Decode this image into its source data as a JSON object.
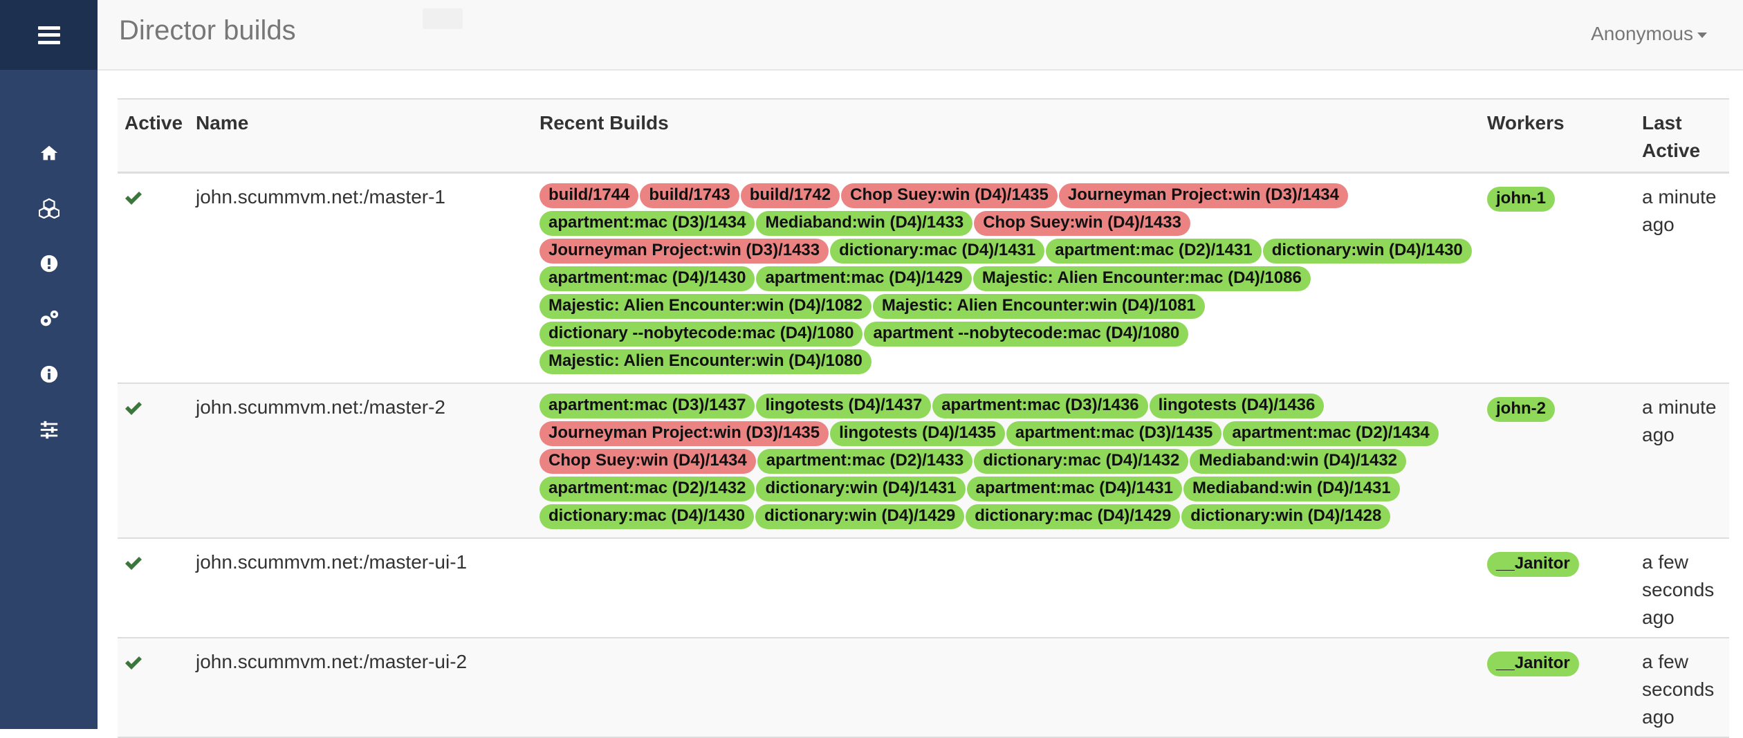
{
  "header": {
    "title": "Director builds",
    "user": "Anonymous"
  },
  "sidebar": {
    "items": [
      {
        "icon": "home-icon"
      },
      {
        "icon": "cubes-icon"
      },
      {
        "icon": "exclamation-icon"
      },
      {
        "icon": "gears-icon"
      },
      {
        "icon": "info-icon"
      },
      {
        "icon": "sliders-icon"
      }
    ]
  },
  "table": {
    "columns": [
      "Active",
      "Name",
      "Recent Builds",
      "Workers",
      "Last Active"
    ],
    "rows": [
      {
        "active": true,
        "name": "john.scummvm.net:/master-1",
        "builds": [
          {
            "label": "build/1744",
            "status": "fail"
          },
          {
            "label": "build/1743",
            "status": "fail"
          },
          {
            "label": "build/1742",
            "status": "fail"
          },
          {
            "label": "Chop Suey:win (D4)/1435",
            "status": "fail"
          },
          {
            "label": "Journeyman Project:win (D3)/1434",
            "status": "fail"
          },
          {
            "label": "apartment:mac (D3)/1434",
            "status": "ok"
          },
          {
            "label": "Mediaband:win (D4)/1433",
            "status": "ok"
          },
          {
            "label": "Chop Suey:win (D4)/1433",
            "status": "fail"
          },
          {
            "label": "Journeyman Project:win (D3)/1433",
            "status": "fail"
          },
          {
            "label": "dictionary:mac (D4)/1431",
            "status": "ok"
          },
          {
            "label": "apartment:mac (D2)/1431",
            "status": "ok"
          },
          {
            "label": "dictionary:win (D4)/1430",
            "status": "ok"
          },
          {
            "label": "apartment:mac (D4)/1430",
            "status": "ok"
          },
          {
            "label": "apartment:mac (D4)/1429",
            "status": "ok"
          },
          {
            "label": "Majestic: Alien Encounter:mac (D4)/1086",
            "status": "ok"
          },
          {
            "label": "Majestic: Alien Encounter:win (D4)/1082",
            "status": "ok"
          },
          {
            "label": "Majestic: Alien Encounter:win (D4)/1081",
            "status": "ok"
          },
          {
            "label": "dictionary --nobytecode:mac (D4)/1080",
            "status": "ok"
          },
          {
            "label": "apartment --nobytecode:mac (D4)/1080",
            "status": "ok"
          },
          {
            "label": "Majestic: Alien Encounter:win (D4)/1080",
            "status": "ok"
          }
        ],
        "worker": "john-1",
        "last_active": "a minute ago"
      },
      {
        "active": true,
        "name": "john.scummvm.net:/master-2",
        "builds": [
          {
            "label": "apartment:mac (D3)/1437",
            "status": "ok"
          },
          {
            "label": "lingotests (D4)/1437",
            "status": "ok"
          },
          {
            "label": "apartment:mac (D3)/1436",
            "status": "ok"
          },
          {
            "label": "lingotests (D4)/1436",
            "status": "ok"
          },
          {
            "label": "Journeyman Project:win (D3)/1435",
            "status": "fail"
          },
          {
            "label": "lingotests (D4)/1435",
            "status": "ok"
          },
          {
            "label": "apartment:mac (D3)/1435",
            "status": "ok"
          },
          {
            "label": "apartment:mac (D2)/1434",
            "status": "ok"
          },
          {
            "label": "Chop Suey:win (D4)/1434",
            "status": "fail"
          },
          {
            "label": "apartment:mac (D2)/1433",
            "status": "ok"
          },
          {
            "label": "dictionary:mac (D4)/1432",
            "status": "ok"
          },
          {
            "label": "Mediaband:win (D4)/1432",
            "status": "ok"
          },
          {
            "label": "apartment:mac (D2)/1432",
            "status": "ok"
          },
          {
            "label": "dictionary:win (D4)/1431",
            "status": "ok"
          },
          {
            "label": "apartment:mac (D4)/1431",
            "status": "ok"
          },
          {
            "label": "Mediaband:win (D4)/1431",
            "status": "ok"
          },
          {
            "label": "dictionary:mac (D4)/1430",
            "status": "ok"
          },
          {
            "label": "dictionary:win (D4)/1429",
            "status": "ok"
          },
          {
            "label": "dictionary:mac (D4)/1429",
            "status": "ok"
          },
          {
            "label": "dictionary:win (D4)/1428",
            "status": "ok"
          }
        ],
        "worker": "john-2",
        "last_active": "a minute ago"
      },
      {
        "active": true,
        "name": "john.scummvm.net:/master-ui-1",
        "builds": [],
        "worker": "__Janitor",
        "last_active": "a few seconds ago"
      },
      {
        "active": true,
        "name": "john.scummvm.net:/master-ui-2",
        "builds": [],
        "worker": "__Janitor",
        "last_active": "a few seconds ago"
      }
    ]
  },
  "colors": {
    "sidebar": "#2d4369",
    "sidebar_top": "#1e3050",
    "badge_ok": "#8fd85a",
    "badge_fail": "#ec8383",
    "check": "#3c763d"
  }
}
